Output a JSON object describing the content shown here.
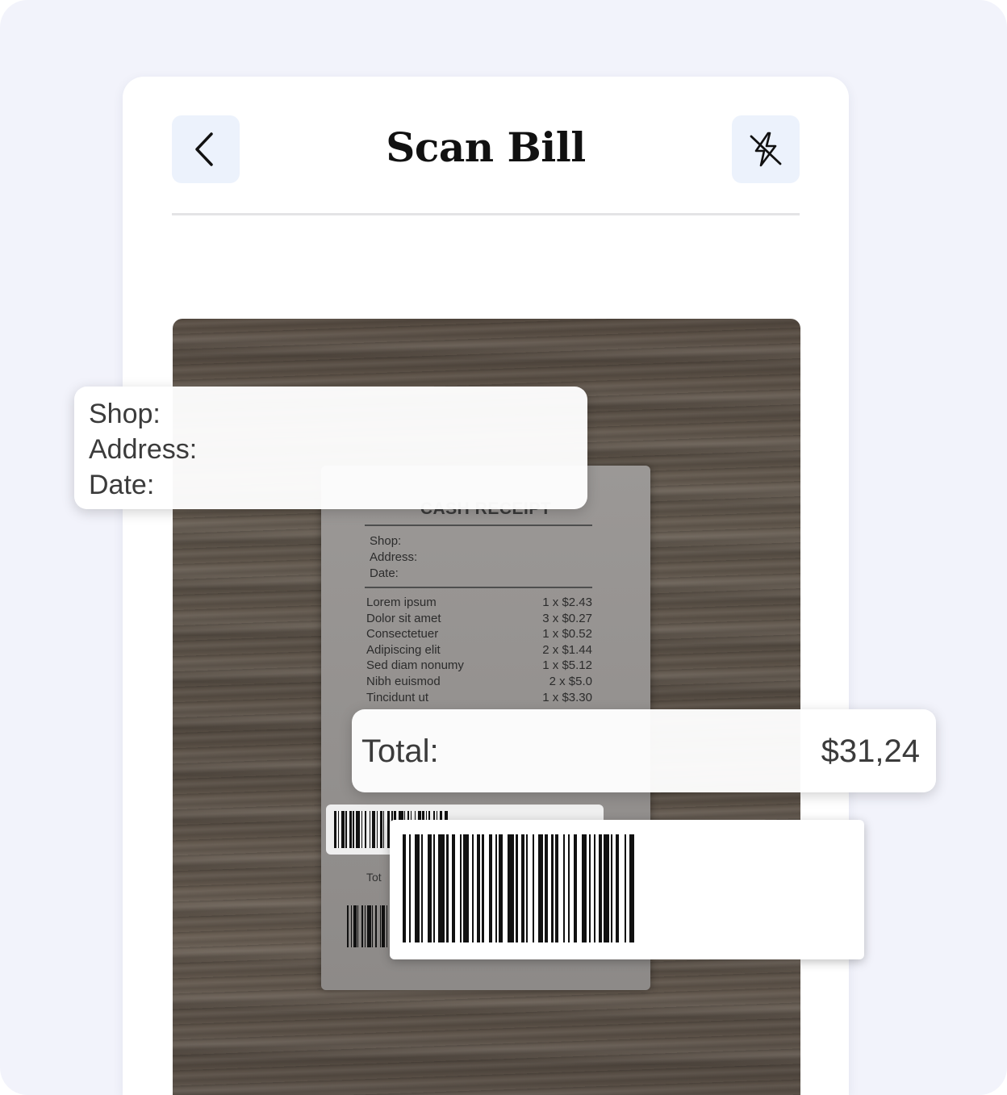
{
  "header": {
    "title": "Scan Bill",
    "back_icon": "chevron-left-icon",
    "flash_icon": "flash-off-icon"
  },
  "colors": {
    "background": "#f2f3fb",
    "icon_button_bg": "#ecf2fc",
    "title_text": "#111111"
  },
  "receipt": {
    "title": "CASH RECEIPT",
    "meta": [
      "Shop:",
      "Address:",
      "Date:"
    ],
    "items": [
      {
        "name": "Lorem ipsum",
        "qty_price": "1 x $2.43"
      },
      {
        "name": "Dolor sit amet",
        "qty_price": "3 x $0.27"
      },
      {
        "name": "Consectetuer",
        "qty_price": "1 x $0.52"
      },
      {
        "name": "Adipiscing elit",
        "qty_price": "2 x $1.44"
      },
      {
        "name": "Sed diam nonumy",
        "qty_price": "1 x $5.12"
      },
      {
        "name": "Nibh euismod",
        "qty_price": "2 x $5.0"
      },
      {
        "name": "Tincidunt ut",
        "qty_price": "1 x $3.30"
      }
    ],
    "total_label_fragment": "Tot"
  },
  "info_card": {
    "shop_label": "Shop:",
    "address_label": "Address:",
    "date_label": "Date:"
  },
  "total_card": {
    "label": "Total:",
    "value": "$31,24"
  }
}
